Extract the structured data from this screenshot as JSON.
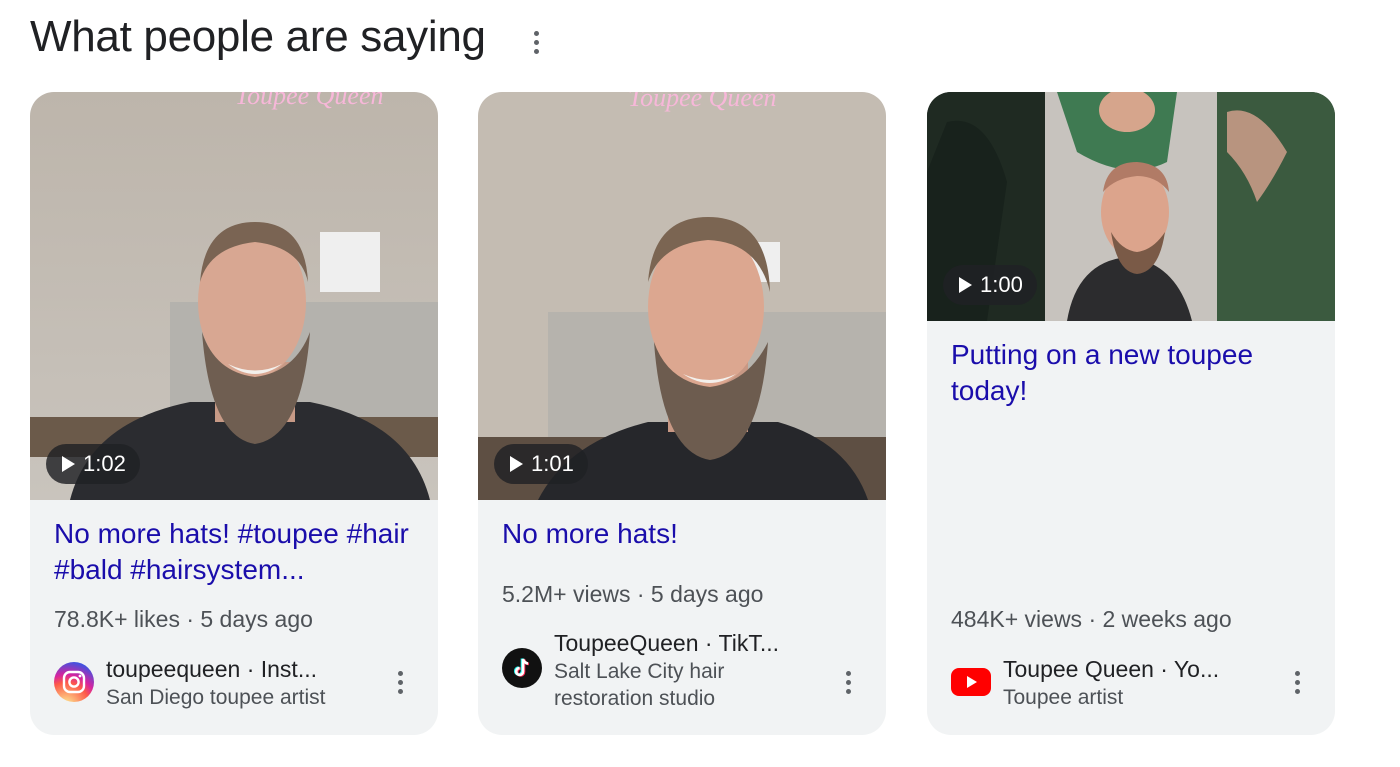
{
  "section": {
    "title": "What people are saying"
  },
  "cards": [
    {
      "duration": "1:02",
      "title": "No more hats! #toupee #hair #bald #hairsystem...",
      "meta": "78.8K+ likes · 5 days ago",
      "source_name": "toupeequeen · Inst...",
      "source_desc": "San Diego toupee artist",
      "source_icon": "instagram-icon"
    },
    {
      "duration": "1:01",
      "title": "No more hats!",
      "meta": "5.2M+ views · 5 days ago",
      "source_name": "ToupeeQueen · TikT...",
      "source_desc": "Salt Lake City hair restoration studio",
      "source_icon": "tiktok-icon"
    },
    {
      "duration": "1:00",
      "title": "Putting on a new toupee today!",
      "meta": "484K+ views · 2 weeks ago",
      "source_name": "Toupee Queen · Yo...",
      "source_desc": "Toupee artist",
      "source_icon": "youtube-icon"
    }
  ],
  "thumbnail_sign_text": "Toupee Queen",
  "colors": {
    "link": "#1a0dab",
    "card_bg": "#f1f3f4",
    "meta": "#4d5156",
    "youtube": "#ff0000"
  }
}
